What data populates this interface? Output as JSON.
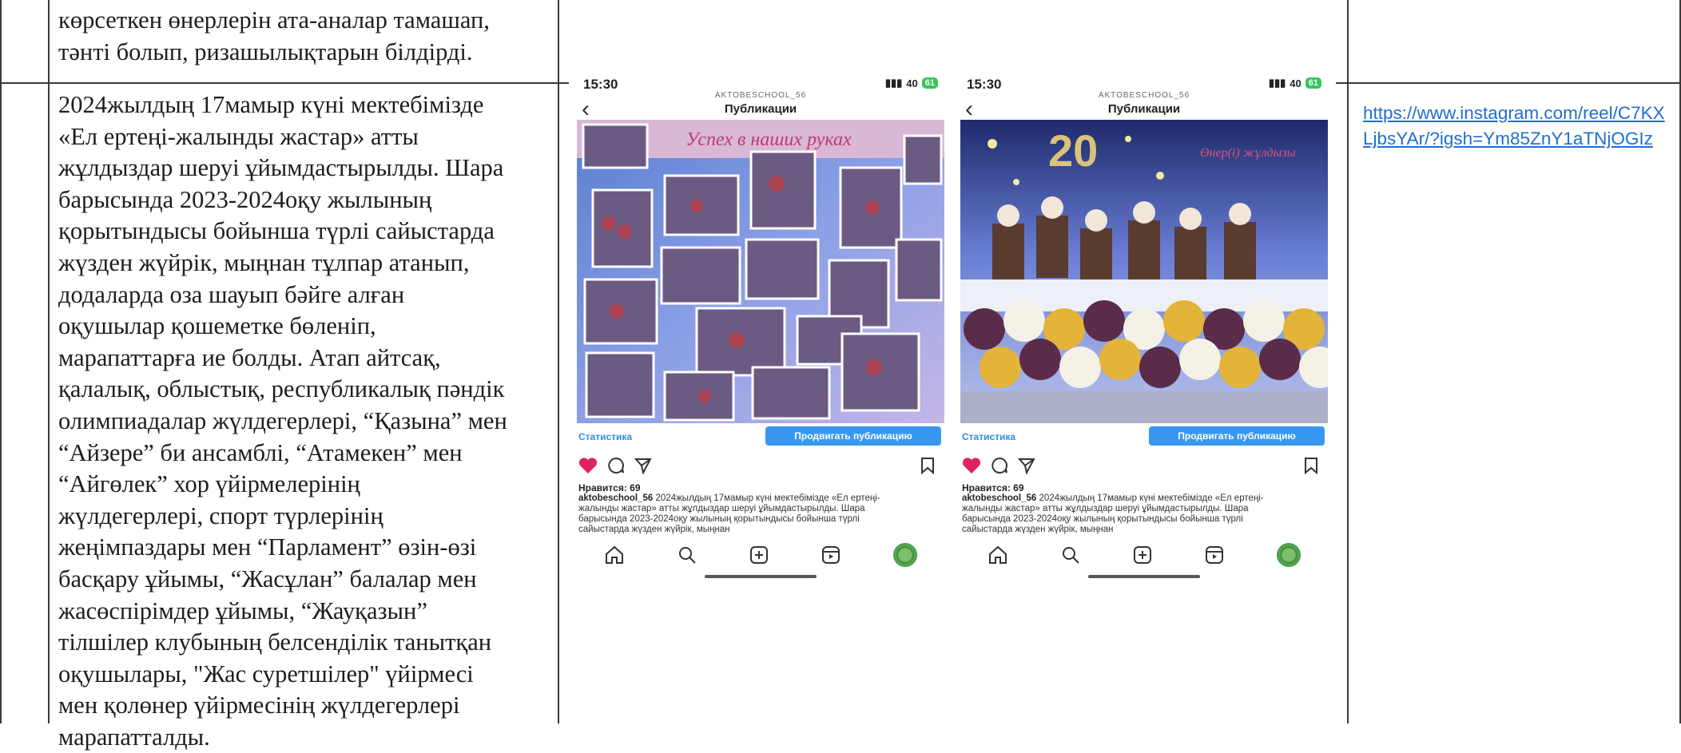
{
  "row1_text": [
    "көрсеткен өнерлерін ата-аналар тамашап,",
    "тәнті болып, ризашылықтарын білдірді."
  ],
  "row2_text": [
    "2024жылдың 17мамыр күні мектебімізде",
    "«Ел ертеңі-жалынды жастар» атты",
    "жұлдыздар шеруі ұйымдастырылды. Шара",
    "барысында 2023-2024оқу жылының",
    "қорытындысы бойынша түрлі сайыстарда",
    "жүзден жүйрік, мыңнан тұлпар атанып,",
    "додаларда оза шауып бәйге алған",
    "оқушылар қошеметке бөленіп,",
    "марапаттарға ие болды. Атап айтсақ,",
    "қалалық, облыстық, республикалық пәндік",
    "олимпиадалар жүлдегерлері, “Қазына” мен",
    "“Айзере” би ансамблі, “Атамекен” мен",
    "“Айгөлек” хор үйірмелерінің",
    "жүлдегерлері, спорт түрлерінің",
    "жеңімпаздары мен “Парламент” өзін-өзі",
    "басқару ұйымы, “Жасұлан” балалар мен",
    "жасөспірімдер ұйымы, “Жауқазын”",
    "тілшілер клубының белсенділік танытқан",
    "оқушылары, \"Жас суретшілер\" үйірмесі",
    "мен қолөнер үйірмесінің жүлдегерлері",
    "марапатталды."
  ],
  "link_text": "https://www.instagram.com/reel/C7KXLjbsYAr/?igsh=Ym85ZnY1aTNjOGIz",
  "phone_left": {
    "time": "15:30",
    "signal": "40",
    "battery": "61",
    "account": "AKTOBESCHOOL_56",
    "title": "Публикации",
    "banner_text": "Успех в наших руках",
    "stats_label": "Статистика",
    "promote_label": "Продвигать публикацию",
    "likes": "Нравится: 69",
    "caption_user": "aktobeschool_56",
    "caption_text": "2024жылдың 17мамыр күні мектебімізде «Ел ертеңі-жалынды жастар» атты жұлдыздар шеруі ұйымдастырылды. Шара барысында 2023-2024оқу жылының қорытындысы бойынша түрлі сайыстарда жүзден жүйрік, мыңнан"
  },
  "phone_right": {
    "time": "15:30",
    "signal": "40",
    "battery": "61",
    "account": "AKTOBESCHOOL_56",
    "title": "Публикации",
    "banner_number": "20",
    "banner_text": "Өнер(і) жұлдызы",
    "stats_label": "Статистика",
    "promote_label": "Продвигать публикацию",
    "likes": "Нравится: 69",
    "caption_user": "aktobeschool_56",
    "caption_text": "2024жылдың 17мамыр күні мектебімізде «Ел ертеңі-жалынды жастар» атты жұлдыздар шеруі ұйымдастырылды. Шара барысында 2023-2024оқу жылының қорытындысы бойынша түрлі сайыстарда жүзден жүйрік, мыңнан"
  },
  "colors": {
    "link": "#1f6fd1",
    "table_line": "#3a3a3a",
    "promote": "#3897f0",
    "heart": "#e0245e"
  },
  "icons": [
    "back-chevron-icon",
    "heart-icon",
    "comment-icon",
    "share-icon",
    "bookmark-icon",
    "home-icon",
    "search-icon",
    "add-icon",
    "reels-icon",
    "profile-avatar-icon"
  ]
}
